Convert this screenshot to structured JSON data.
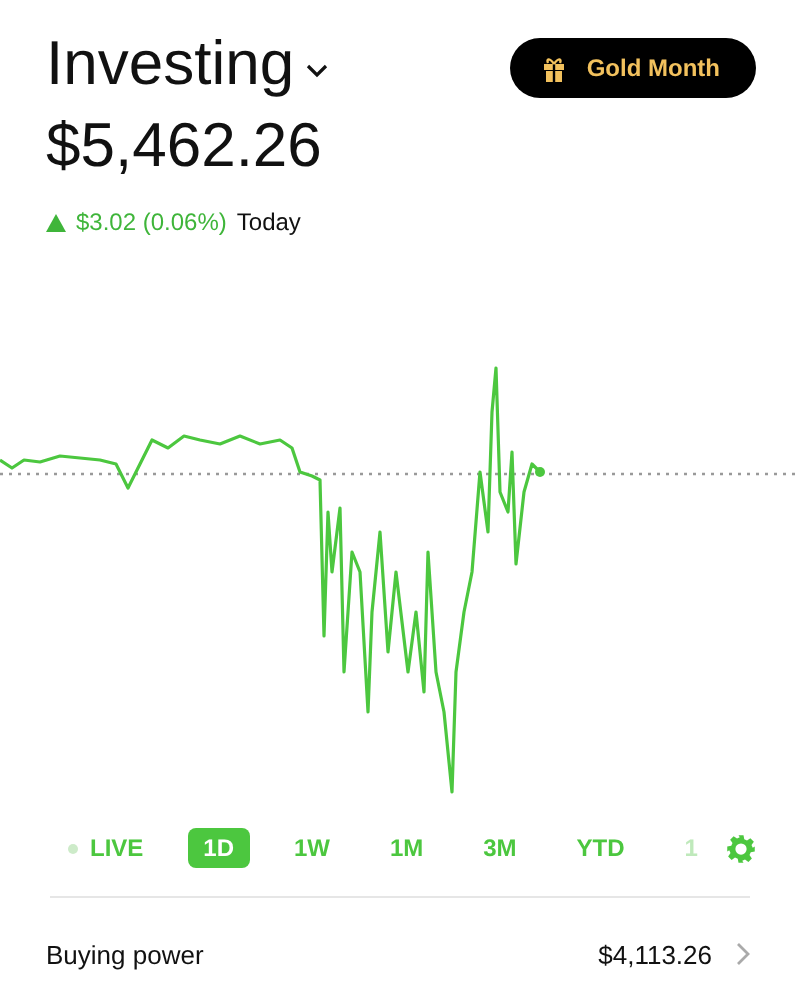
{
  "header": {
    "title": "Investing",
    "balance": "$5,462.26",
    "change": "$3.02 (0.06%)",
    "change_period": "Today"
  },
  "promo_button": {
    "label": "Gold Month"
  },
  "ranges": [
    {
      "label": "LIVE",
      "kind": "live",
      "selected": false
    },
    {
      "label": "1D",
      "kind": "range",
      "selected": true
    },
    {
      "label": "1W",
      "kind": "range",
      "selected": false
    },
    {
      "label": "1M",
      "kind": "range",
      "selected": false
    },
    {
      "label": "3M",
      "kind": "range",
      "selected": false
    },
    {
      "label": "YTD",
      "kind": "range",
      "selected": false
    },
    {
      "label": "1",
      "kind": "cut",
      "selected": false
    }
  ],
  "buying_power": {
    "label": "Buying power",
    "value": "$4,113.26"
  }
}
